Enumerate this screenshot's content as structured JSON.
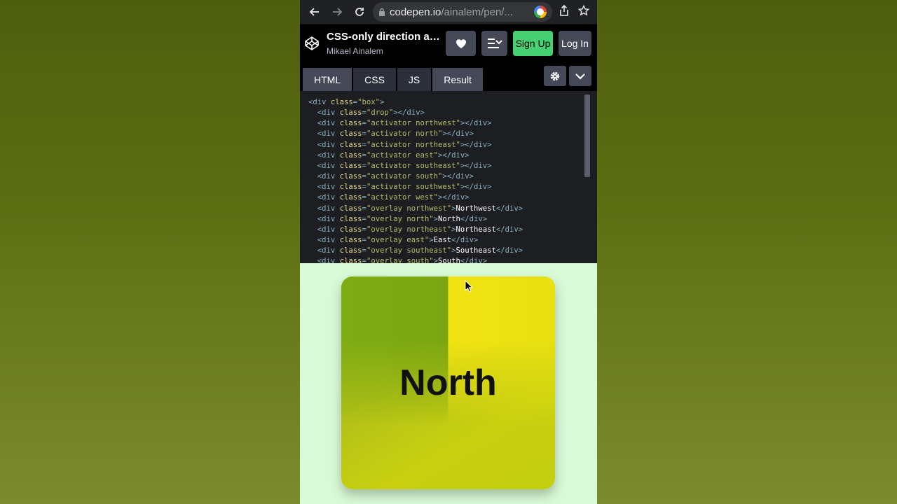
{
  "browser": {
    "url_host": "codepen.io",
    "url_path": "/ainalem/pen/...",
    "back_icon": "arrow-left-icon",
    "forward_icon": "arrow-right-icon",
    "reload_icon": "reload-icon"
  },
  "header": {
    "title": "CSS-only direction awa...",
    "author": "Mikael Ainalem",
    "signup_label": "Sign Up",
    "login_label": "Log In"
  },
  "tabs": [
    {
      "label": "HTML"
    },
    {
      "label": "CSS"
    },
    {
      "label": "JS"
    },
    {
      "label": "Result"
    }
  ],
  "code_lines": [
    {
      "indent": "",
      "tag": "div",
      "cls": "box",
      "text": "",
      "close": false
    },
    {
      "indent": "  ",
      "tag": "div",
      "cls": "drop",
      "text": "",
      "close": true
    },
    {
      "indent": "  ",
      "tag": "div",
      "cls": "activator northwest",
      "text": "",
      "close": true
    },
    {
      "indent": "  ",
      "tag": "div",
      "cls": "activator north",
      "text": "",
      "close": true
    },
    {
      "indent": "  ",
      "tag": "div",
      "cls": "activator northeast",
      "text": "",
      "close": true
    },
    {
      "indent": "  ",
      "tag": "div",
      "cls": "activator east",
      "text": "",
      "close": true
    },
    {
      "indent": "  ",
      "tag": "div",
      "cls": "activator southeast",
      "text": "",
      "close": true
    },
    {
      "indent": "  ",
      "tag": "div",
      "cls": "activator south",
      "text": "",
      "close": true
    },
    {
      "indent": "  ",
      "tag": "div",
      "cls": "activator southwest",
      "text": "",
      "close": true
    },
    {
      "indent": "  ",
      "tag": "div",
      "cls": "activator west",
      "text": "",
      "close": true
    },
    {
      "indent": "  ",
      "tag": "div",
      "cls": "overlay northwest",
      "text": "Northwest",
      "close": true
    },
    {
      "indent": "  ",
      "tag": "div",
      "cls": "overlay north",
      "text": "North",
      "close": true
    },
    {
      "indent": "  ",
      "tag": "div",
      "cls": "overlay northeast",
      "text": "Northeast",
      "close": true
    },
    {
      "indent": "  ",
      "tag": "div",
      "cls": "overlay east",
      "text": "East",
      "close": true
    },
    {
      "indent": "  ",
      "tag": "div",
      "cls": "overlay southeast",
      "text": "Southeast",
      "close": true
    },
    {
      "indent": "  ",
      "tag": "div",
      "cls": "overlay south",
      "text": "South",
      "close": true
    }
  ],
  "result": {
    "overlay_text": "North"
  },
  "colors": {
    "signup_green": "#47cf73",
    "editor_bg": "#1d1e22",
    "result_bg": "#d9fad6"
  }
}
